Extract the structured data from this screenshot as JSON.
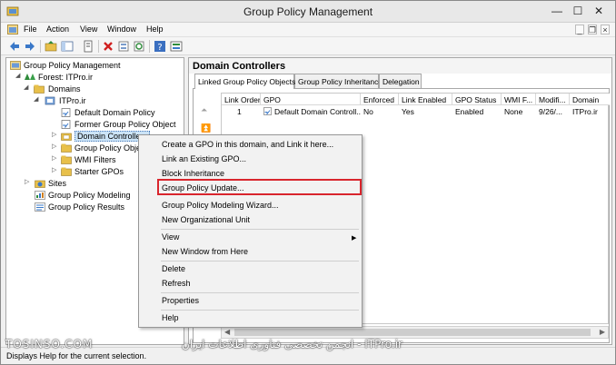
{
  "window": {
    "title": "Group Policy Management",
    "min_glyph": "—",
    "max_glyph": "☐",
    "close_glyph": "✕"
  },
  "menubar": {
    "items": [
      "File",
      "Action",
      "View",
      "Window",
      "Help"
    ],
    "mdi_min": "_",
    "mdi_restore": "❐",
    "mdi_close": "×"
  },
  "tree": {
    "items": [
      {
        "label": "Group Policy Management",
        "icon": "gpm-console-icon"
      },
      {
        "label": "Forest: ITPro.ir",
        "icon": "forest-icon"
      },
      {
        "label": "Domains",
        "icon": "folder-icon"
      },
      {
        "label": "ITPro.ir",
        "icon": "domain-icon"
      },
      {
        "label": "Default Domain Policy",
        "icon": "gpo-link-icon"
      },
      {
        "label": "Former Group Policy Object",
        "icon": "gpo-link-icon"
      },
      {
        "label": "Domain Controllers",
        "icon": "ou-icon"
      },
      {
        "label": "Group Policy Obje",
        "icon": "folder-icon"
      },
      {
        "label": "WMI Filters",
        "icon": "folder-icon"
      },
      {
        "label": "Starter GPOs",
        "icon": "folder-icon"
      },
      {
        "label": "Sites",
        "icon": "sites-icon"
      },
      {
        "label": "Group Policy Modeling",
        "icon": "modeling-icon"
      },
      {
        "label": "Group Policy Results",
        "icon": "results-icon"
      }
    ]
  },
  "right_pane": {
    "title": "Domain Controllers",
    "tabs": [
      "Linked Group Policy Objects",
      "Group Policy Inheritance",
      "Delegation"
    ],
    "columns": [
      "Link Order",
      "GPO",
      "Enforced",
      "Link Enabled",
      "GPO Status",
      "WMI F...",
      "Modifi...",
      "Domain"
    ],
    "rows": [
      [
        "1",
        "Default Domain Controll...",
        "No",
        "Yes",
        "Enabled",
        "None",
        "9/26/...",
        "ITPro.ir"
      ]
    ]
  },
  "context_menu": {
    "items": [
      "Create a GPO in this domain, and Link it here...",
      "Link an Existing GPO...",
      "Block Inheritance",
      "Group Policy Update...",
      "Group Policy Modeling Wizard...",
      "New Organizational Unit",
      "View",
      "New Window from Here",
      "Delete",
      "Refresh",
      "Properties",
      "Help"
    ],
    "highlighted": "Group Policy Update...",
    "highlight_color": "#d9252d"
  },
  "statusbar": {
    "text": "Displays Help for the current selection."
  },
  "watermarks": {
    "left": "TOSINSO.COM",
    "right": "انجمن تخصصی فناوری اطلاعات ایران - ITPro.ir"
  }
}
